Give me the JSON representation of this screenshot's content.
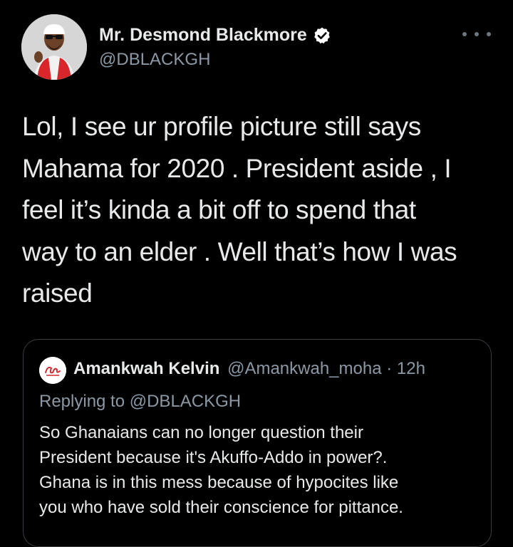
{
  "author": {
    "display_name": "Mr. Desmond Blackmore",
    "handle": "@DBLACKGH",
    "verified": true
  },
  "tweet": {
    "lines": [
      "Lol, I see ur profile picture still says",
      "Mahama for 2020 . President aside , I",
      "feel it’s kinda a bit off to spend that",
      "way to an elder . Well that’s how I was",
      "raised"
    ]
  },
  "quoted_tweet": {
    "display_name": "Amankwah Kelvin",
    "handle_time": "@Amankwah_moha · 12h",
    "replying_to": "Replying to @DBLACKGH",
    "lines": [
      "So Ghanaians can no longer question their",
      "President because it's Akuffo-Addo in power?.",
      "Ghana is in this mess because of hypocites like",
      "you who have sold their conscience for pittance."
    ]
  },
  "icons": {
    "verified": "verified-badge-icon",
    "more": "more-options-icon"
  },
  "colors": {
    "background": "#000000",
    "text": "#e7e9ea",
    "secondary_text": "#8b98a5",
    "border": "#3a3d41",
    "verified_badge": "#ffffff"
  }
}
